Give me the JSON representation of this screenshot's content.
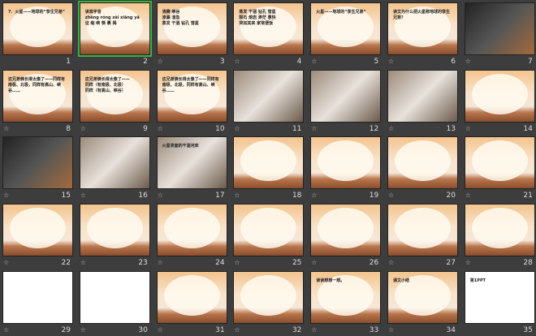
{
  "slides": [
    {
      "n": "1",
      "text": "7．火星——地球的“孪生兄弟”",
      "anim": false,
      "style": "normal"
    },
    {
      "n": "2",
      "text": "读准字音\nzhēng róng zài xiāng yǎ\n证 缩 峡 筷 裹 揭",
      "anim": false,
      "style": "normal",
      "selected": true
    },
    {
      "n": "3",
      "text": "沸腾 峡谷\n渗漏 湍急\n蒸发 干涸 钻孔 彗星",
      "anim": true,
      "style": "normal"
    },
    {
      "n": "4",
      "text": "蒸发 干涸 钻孔 彗星\n陨石 熔岩 渺茫 惠快\n突如其来 家常便饭",
      "anim": true,
      "style": "normal"
    },
    {
      "n": "5",
      "text": "火星——地球的“孪生兄弟”",
      "anim": true,
      "style": "normal"
    },
    {
      "n": "6",
      "text": "读文为什么把火星称地球的孪生兄弟？",
      "anim": true,
      "style": "normal"
    },
    {
      "n": "7",
      "text": "",
      "anim": true,
      "style": "dark"
    },
    {
      "n": "8",
      "text": "这兄弟俩长得太像了——同样有南极、北极，同样有高山、峡谷……",
      "anim": true,
      "style": "normal"
    },
    {
      "n": "9",
      "text": "这兄弟俩长得太像了——\n同样（有南极、北极）\n同样（有高山、峡谷）",
      "anim": true,
      "style": "normal"
    },
    {
      "n": "10",
      "text": "这兄弟俩长得太像了——同样有南极、北极，同样有高山、峡谷……",
      "anim": true,
      "style": "normal"
    },
    {
      "n": "11",
      "text": "",
      "anim": true,
      "style": "photo"
    },
    {
      "n": "12",
      "text": "",
      "anim": true,
      "style": "photo"
    },
    {
      "n": "13",
      "text": "",
      "anim": true,
      "style": "photo"
    },
    {
      "n": "14",
      "text": "",
      "anim": true,
      "style": "normal"
    },
    {
      "n": "15",
      "text": "",
      "anim": true,
      "style": "dark"
    },
    {
      "n": "16",
      "text": "",
      "anim": true,
      "style": "photo"
    },
    {
      "n": "17",
      "text": "火星表面的干涸河床",
      "anim": true,
      "style": "photo"
    },
    {
      "n": "18",
      "text": "",
      "anim": true,
      "style": "normal"
    },
    {
      "n": "19",
      "text": "",
      "anim": true,
      "style": "normal"
    },
    {
      "n": "20",
      "text": "",
      "anim": true,
      "style": "normal"
    },
    {
      "n": "21",
      "text": "",
      "anim": true,
      "style": "normal"
    },
    {
      "n": "22",
      "text": "",
      "anim": true,
      "style": "normal"
    },
    {
      "n": "23",
      "text": "",
      "anim": true,
      "style": "normal"
    },
    {
      "n": "24",
      "text": "",
      "anim": true,
      "style": "normal"
    },
    {
      "n": "25",
      "text": "",
      "anim": true,
      "style": "normal"
    },
    {
      "n": "26",
      "text": "",
      "anim": true,
      "style": "normal"
    },
    {
      "n": "27",
      "text": "",
      "anim": true,
      "style": "normal"
    },
    {
      "n": "28",
      "text": "",
      "anim": true,
      "style": "normal"
    },
    {
      "n": "29",
      "text": "",
      "anim": true,
      "style": "white"
    },
    {
      "n": "30",
      "text": "",
      "anim": true,
      "style": "white"
    },
    {
      "n": "31",
      "text": "",
      "anim": true,
      "style": "normal"
    },
    {
      "n": "32",
      "text": "",
      "anim": true,
      "style": "normal"
    },
    {
      "n": "33",
      "text": "读读想想一想。",
      "anim": true,
      "style": "normal"
    },
    {
      "n": "34",
      "text": "课文小结",
      "anim": true,
      "style": "normal"
    },
    {
      "n": "35",
      "text": "第1PPT",
      "anim": false,
      "style": "white"
    }
  ]
}
